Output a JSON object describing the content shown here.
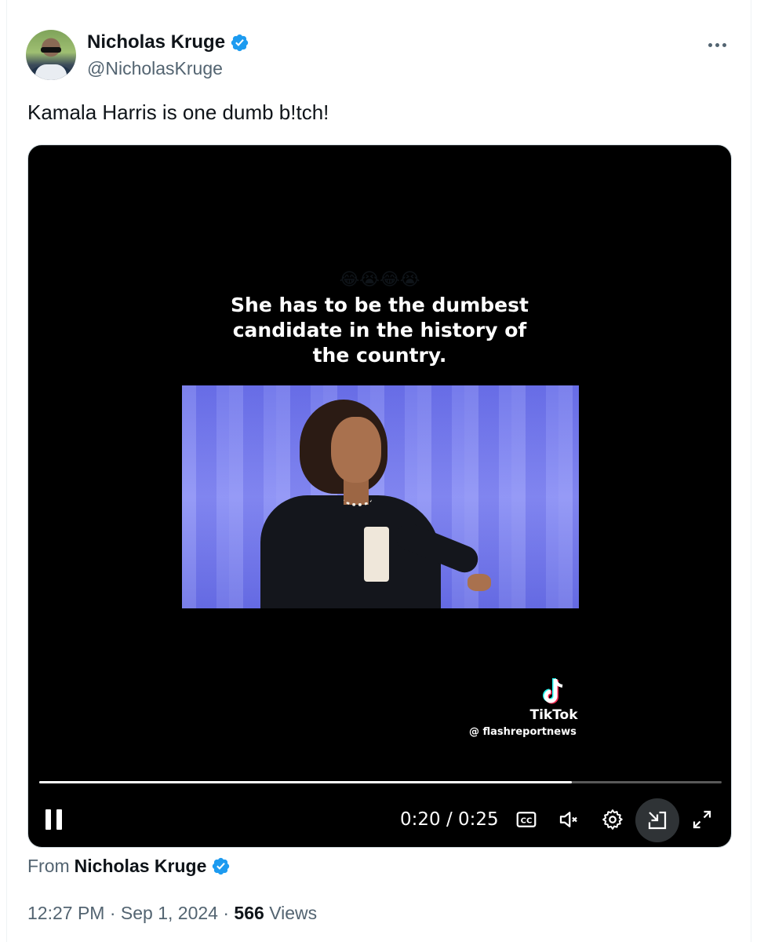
{
  "author": {
    "display_name": "Nicholas Kruge",
    "handle": "@NicholasKruge",
    "verified": true
  },
  "tweet": {
    "text": "Kamala Harris is one dumb b!tch!"
  },
  "video": {
    "emoji": "😂😭😂😭",
    "caption_line1": "She has to be the dumbest",
    "caption_line2": "candidate in the history of",
    "caption_line3": "the country.",
    "watermark_brand": "TikTok",
    "watermark_user": "@ flashreportnews",
    "current_time": "0:20",
    "time_separator": "/",
    "duration": "0:25",
    "progress_fraction": 0.78,
    "time_display": "0:20 / 0:25"
  },
  "source": {
    "label": "From",
    "name": "Nicholas Kruge"
  },
  "meta": {
    "time": "12:27 PM",
    "date": "Sep 1, 2024",
    "views_count": "566",
    "views_label": "Views"
  },
  "colors": {
    "verified_blue": "#1d9bf0",
    "secondary_text": "#536471",
    "primary_text": "#0f1419"
  }
}
